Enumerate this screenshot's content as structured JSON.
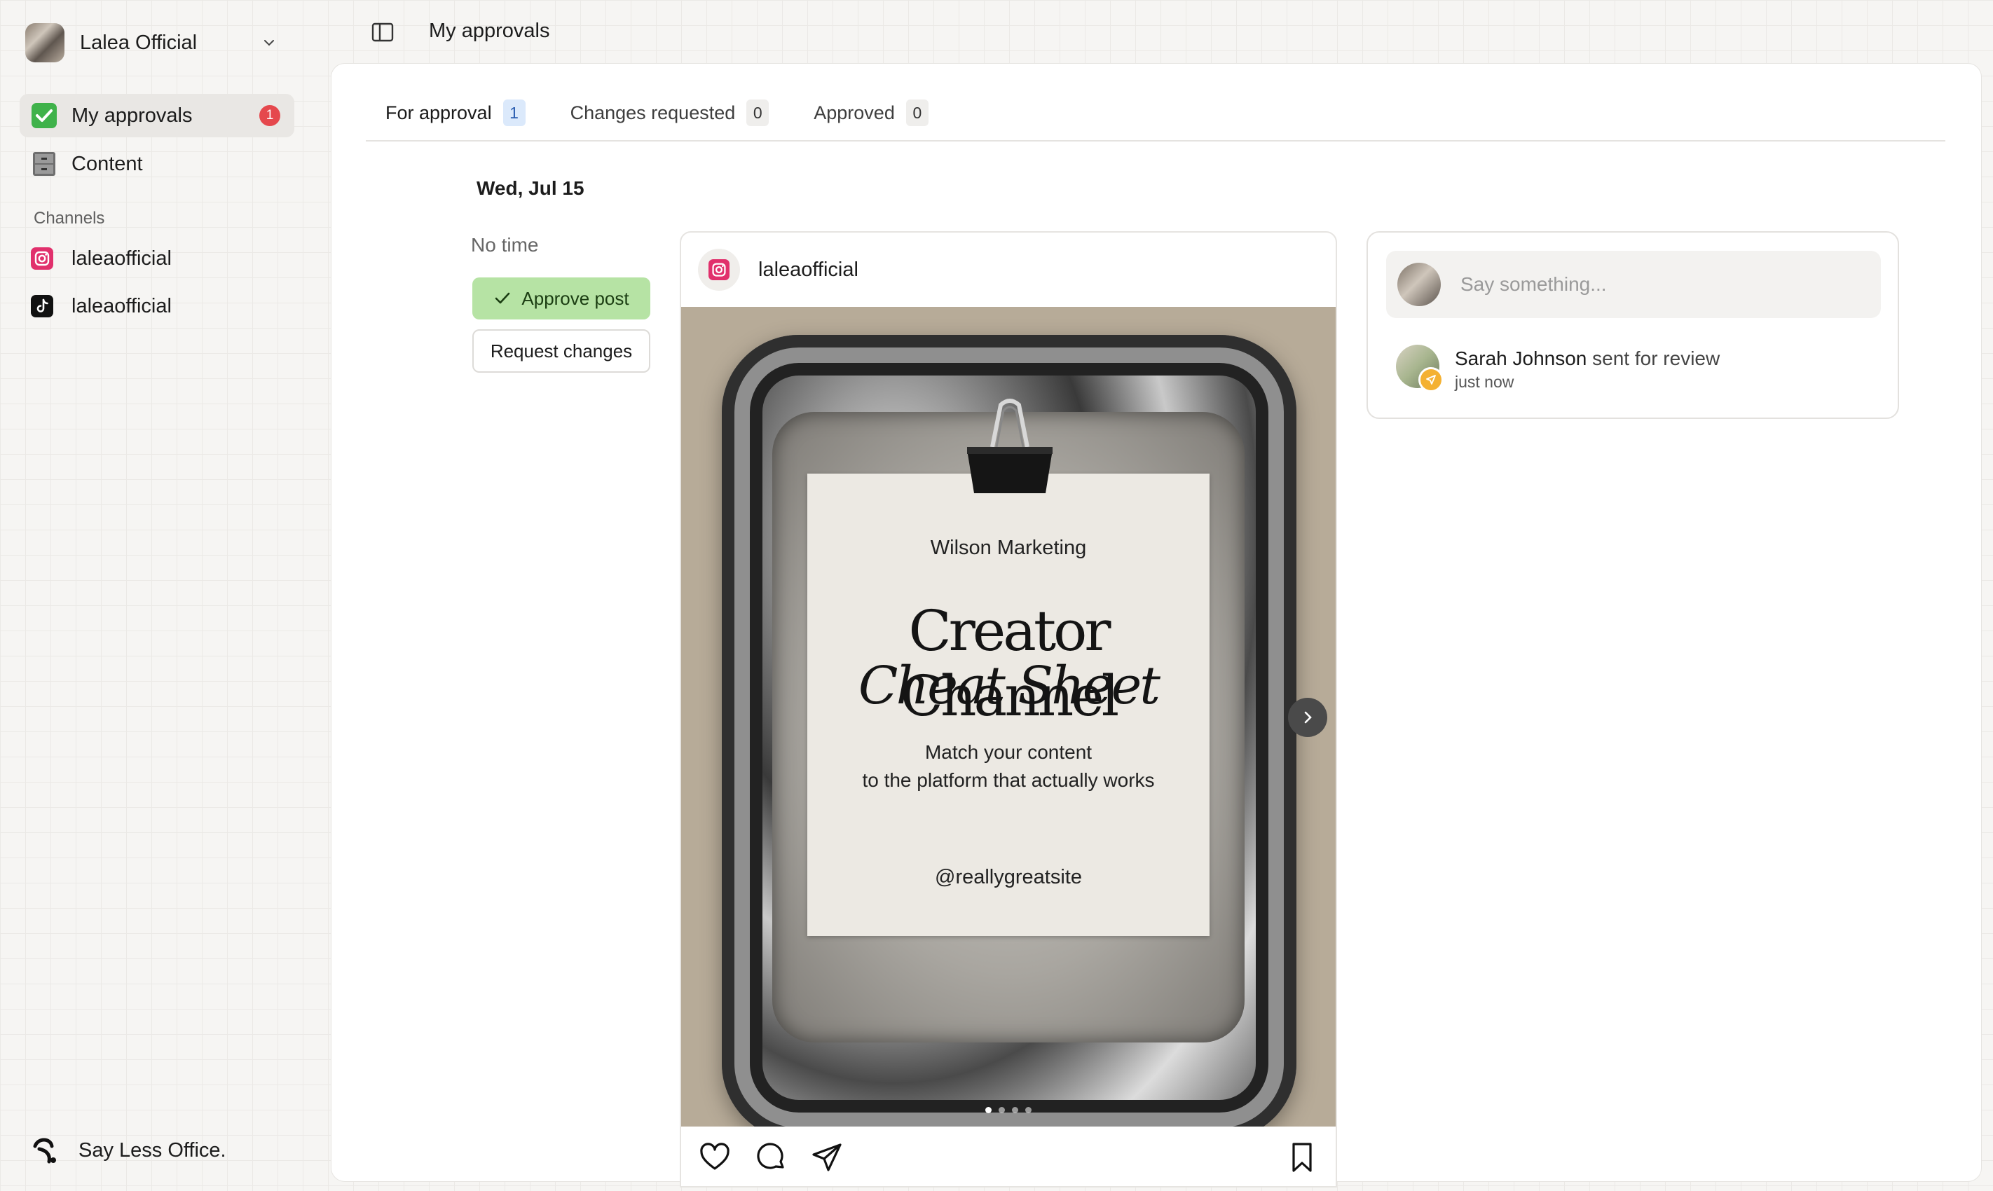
{
  "workspace": {
    "name": "Lalea Official"
  },
  "sidebar": {
    "items": [
      {
        "label": "My approvals",
        "icon": "check-box-icon",
        "badge": "1",
        "active": true
      },
      {
        "label": "Content",
        "icon": "file-cabinet-icon"
      }
    ],
    "channels_label": "Channels",
    "channels": [
      {
        "label": "laleaofficial",
        "icon": "instagram-icon"
      },
      {
        "label": "laleaofficial",
        "icon": "tiktok-icon"
      }
    ],
    "footer": {
      "label": "Say Less Office."
    }
  },
  "header": {
    "title": "My approvals"
  },
  "tabs": [
    {
      "label": "For approval",
      "count": "1",
      "active": true
    },
    {
      "label": "Changes requested",
      "count": "0"
    },
    {
      "label": "Approved",
      "count": "0"
    }
  ],
  "schedule": {
    "date": "Wed, Jul 15",
    "time": "No time",
    "approve_label": "Approve post",
    "request_label": "Request changes"
  },
  "post": {
    "handle": "laleaofficial",
    "image": {
      "brand": "Wilson Marketing",
      "title_line1": "Creator Channel",
      "title_line2": "Cheat Sheet",
      "subtitle_line1": "Match your content",
      "subtitle_line2": "to the platform that actually works",
      "handle": "@reallygreatsite"
    }
  },
  "comments": {
    "placeholder": "Say something...",
    "activity": {
      "user": "Sarah Johnson",
      "action": "sent for review",
      "time": "just now"
    }
  },
  "colors": {
    "approve": "#b6e3a4",
    "badge": "#e5484d",
    "active_tab_count": "#dbe9fb"
  }
}
